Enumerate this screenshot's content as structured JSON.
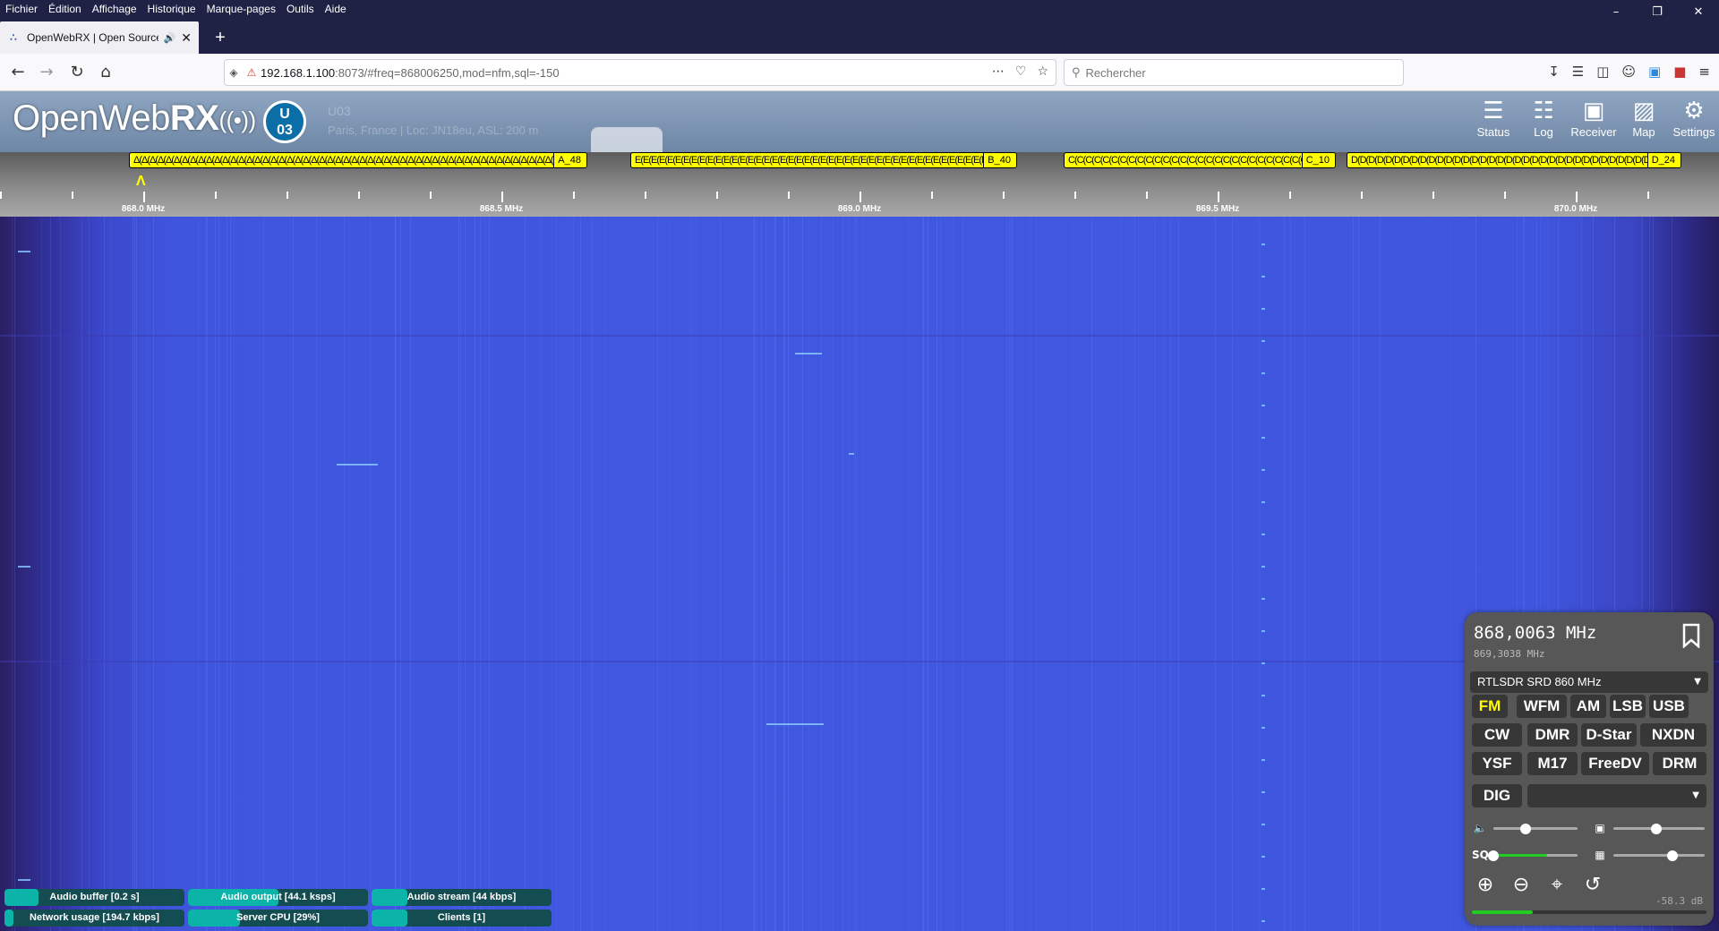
{
  "browser": {
    "menu": [
      "Fichier",
      "Édition",
      "Affichage",
      "Historique",
      "Marque-pages",
      "Outils",
      "Aide"
    ],
    "tab_title": "OpenWebRX | Open Source",
    "url_host": "192.168.1.100",
    "url_rest": ":8073/#freq=868006250,mod=nfm,sql=-150",
    "search_placeholder": "Rechercher"
  },
  "header": {
    "logo_light": "OpenWeb",
    "logo_bold": "RX",
    "avatar_line1": "U",
    "avatar_line2": "03",
    "receiver_name": "U03",
    "receiver_location": "Paris, France | Loc: JN18eu, ASL: 200 m",
    "buttons": [
      {
        "label": "Status",
        "icon": "status-icon"
      },
      {
        "label": "Log",
        "icon": "log-icon"
      },
      {
        "label": "Receiver",
        "icon": "receiver-icon"
      },
      {
        "label": "Map",
        "icon": "map-icon"
      },
      {
        "label": "Settings",
        "icon": "settings-icon"
      }
    ]
  },
  "bookmarks": {
    "groups": [
      {
        "prefix": "A",
        "repeat": "Δ",
        "last": "A_48"
      },
      {
        "prefix": "B",
        "repeat": "E",
        "last": "B_40"
      },
      {
        "prefix": "C",
        "repeat": "C",
        "last": "C_10"
      },
      {
        "prefix": "D",
        "repeat": "D",
        "last": "D_24"
      }
    ]
  },
  "scale": {
    "labels": [
      "868.0 MHz",
      "868.5 MHz",
      "869.0 MHz",
      "869.5 MHz",
      "870.0 MHz"
    ]
  },
  "status": {
    "audio_buffer": "Audio buffer [0.2 s]",
    "audio_output": "Audio output [44.1 ksps]",
    "audio_stream": "Audio stream [44 kbps]",
    "network_usage": "Network usage [194.7 kbps]",
    "server_cpu": "Server CPU [29%]",
    "clients": "Clients [1]",
    "levels": {
      "audio_buffer": 0.19,
      "audio_output": 0.5,
      "audio_stream": 0.2,
      "network_usage": 0.05,
      "server_cpu": 0.29,
      "clients": 0.2
    }
  },
  "panel": {
    "frequency": "868,0063 MHz",
    "frequency_sub": "869,3038 MHz",
    "profile": "RTLSDR SRD 860 MHz",
    "modes_row1": [
      "FM",
      "WFM",
      "AM",
      "LSB",
      "USB"
    ],
    "modes_row2": [
      "CW",
      "DMR",
      "D-Star",
      "NXDN"
    ],
    "modes_row3": [
      "YSF",
      "M17",
      "FreeDV",
      "DRM"
    ],
    "dig": "DIG",
    "active_mode": "FM",
    "squelch_label": "SQ",
    "smeter_value": "-58.3 dB",
    "volume_level": 0.38,
    "squelch_level": 0.0,
    "nr_level": 0.47,
    "gain_level": 0.65,
    "smeter_level": 0.26,
    "colors": {
      "active": "#ffff00",
      "panel": "#575757",
      "button": "#373737"
    }
  }
}
